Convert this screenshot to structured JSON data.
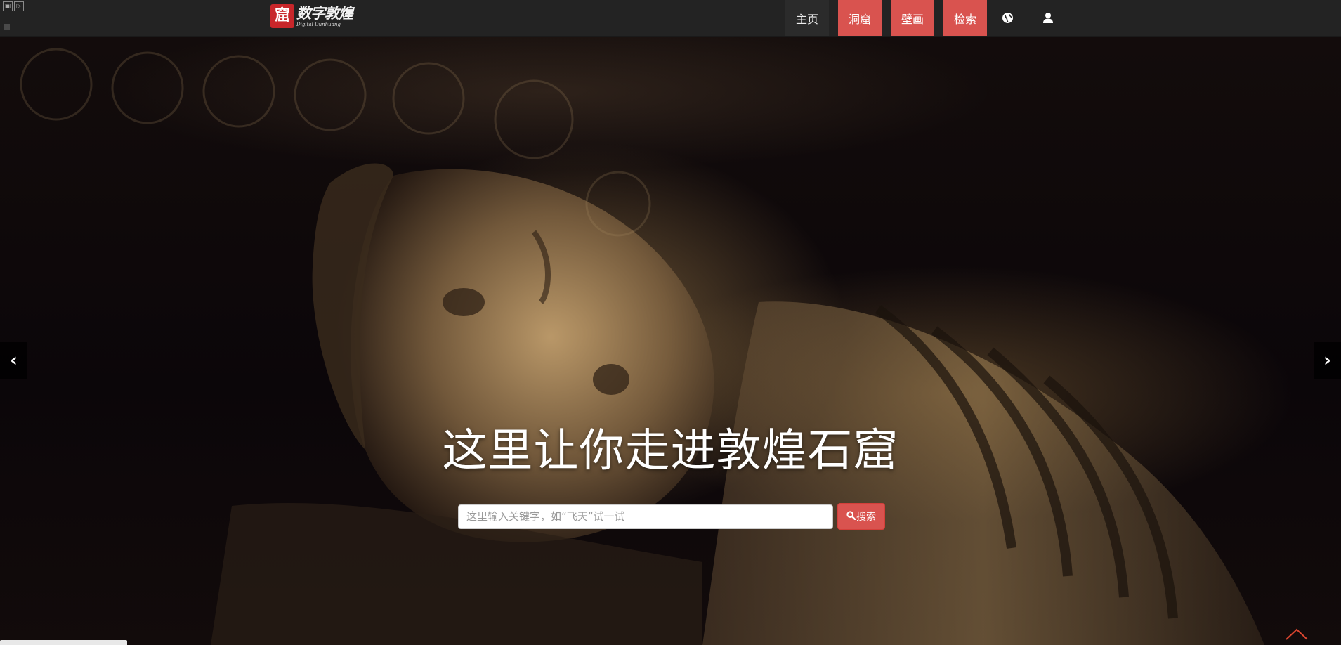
{
  "header": {
    "logo": {
      "mark": "窟",
      "title": "数字敦煌",
      "subtitle": "Digital Dunhuang"
    },
    "nav": {
      "home": "主页",
      "caves": "洞窟",
      "murals": "壁画",
      "search": "检索"
    },
    "icons": {
      "language": "globe-icon",
      "account": "user-icon"
    }
  },
  "hero": {
    "headline": "这里让你走进敦煌石窟",
    "search": {
      "placeholder": "这里输入关键字，如“飞天”试一试",
      "value": "",
      "button_label": "搜索"
    },
    "carousel": {
      "prev_symbol": "‹",
      "next_symbol": "›"
    }
  },
  "colors": {
    "accent": "#d9534f",
    "topbar": "#232323"
  }
}
